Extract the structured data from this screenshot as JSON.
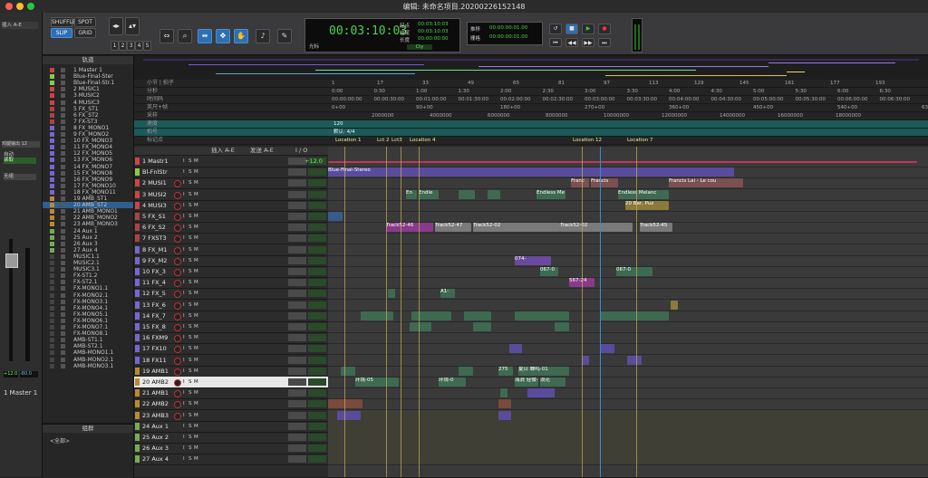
{
  "window": {
    "title": "编辑: 未命名项目.20200226152148"
  },
  "toolbar": {
    "edit_modes": [
      "SHUFFLE",
      "SPOT",
      "SLIP",
      "GRID"
    ],
    "zoom_presets": [
      "1",
      "2",
      "3",
      "4",
      "5"
    ],
    "main_counter": "00:03:10:03",
    "counter_label": "光标",
    "start_label": "起点",
    "end_label": "结尾",
    "length_label": "长度",
    "start_value": "00:03:10:03",
    "end_value": "00:03:10:03",
    "length_value": "00:00:00:00",
    "nudge_label": "推移",
    "grid_label": "栅格",
    "nudge_value": "00:00:00:01.00",
    "grid_value": "00:00:00:01.00",
    "grid_text": "Cty"
  },
  "left_strip": {
    "insert_label": "插入 A-E",
    "track_label": "鸡腿输出 12",
    "auto_label": "自动",
    "auto_value": "读取",
    "group_label": "无组",
    "fader_left": "+12.0",
    "fader_right": "-80.0",
    "track_name": "1  Master 1"
  },
  "tracklist": {
    "header": "轨道",
    "items": [
      "1 Master 1",
      "Blue-Final-Ster",
      "Blue-Final-Str.1",
      "2 MUSIC1",
      "3 MUSIC2",
      "4 MUSIC3",
      "5 FX_ST1",
      "6 FX_ST2",
      "7 FX-ST3",
      "8 FX_MONO1",
      "9 FX_MONO2",
      "10 FX_MONO3",
      "11 FX_MONO4",
      "12 FX_MONO5",
      "13 FX_MONO6",
      "14 FX_MONO7",
      "15 FX_MONO8",
      "16 FX_MONO9",
      "17 FX_MONO10",
      "18 FX_MONO11",
      "19 AMB_ST1",
      "20 AMB_ST2",
      "21 AMB_MONO1",
      "22 AMB_MONO2",
      "23 AMB_MONO3",
      "24 Aux 1",
      "25 Aux 2",
      "26 Aux 3",
      "27 Aux 4",
      "MUSIC1.1",
      "MUSIC2.1",
      "MUSIC3.1",
      "FX-ST1.2",
      "FX-ST2.1",
      "FX-MONO1.1",
      "FX-MONO2.1",
      "FX-MONO3.1",
      "FX-MONO4.1",
      "FX-MONO5.1",
      "FX-MONO6.1",
      "FX-MONO7.1",
      "FX-MONO8.1",
      "AMB-ST1.1",
      "AMB-ST2.1",
      "AMB-MONO1.1",
      "AMB-MONO2.1",
      "AMB-MONO3.1"
    ],
    "groups_header": "组群",
    "groups_item": "<全部>"
  },
  "rulers": {
    "labels": [
      "小节 | 拍子",
      "分秒",
      "时间码",
      "英尺+帧",
      "采样",
      "速度",
      "拍号",
      "标记点"
    ],
    "bars": [
      "1",
      "17",
      "33",
      "49",
      "65",
      "81",
      "97",
      "113",
      "129",
      "145",
      "161",
      "177",
      "193"
    ],
    "minsecs": [
      "0:00",
      "0:30",
      "1:00",
      "1:30",
      "2:00",
      "2:30",
      "3:00",
      "3:30",
      "4:00",
      "4:30",
      "5:00",
      "5:30",
      "6:00",
      "6:30"
    ],
    "timecodes": [
      "00:00:00:00",
      "00:00:30:00",
      "00:01:00:00",
      "00:01:30:00",
      "00:02:00:00",
      "00:02:30:00",
      "00:03:00:00",
      "00:03:30:00",
      "00:04:00:00",
      "00:04:30:00",
      "00:05:00:00",
      "00:05:30:00",
      "00:06:00:00",
      "00:06:30:00"
    ],
    "feet": [
      "0+00",
      "90+00",
      "180+00",
      "270+00",
      "360+00",
      "450+00",
      "540+00",
      "630+00"
    ],
    "samples": [
      "2000000",
      "4000000",
      "6000000",
      "8000000",
      "10000000",
      "12000000",
      "14000000",
      "16000000",
      "18000000"
    ],
    "tempo": "120",
    "meter": "默认: 4/4",
    "markers": [
      "Location 1",
      "Lct 2",
      "Lct3",
      "Location 4",
      "Location 12",
      "Location 7"
    ]
  },
  "track_header": {
    "col_insert": "插入 A-E",
    "col_send": "发送 A-E",
    "col_io": "I / O"
  },
  "tracks": [
    {
      "name": "1  Mastr1",
      "color": "#c44",
      "level": "+12.0"
    },
    {
      "name": "Bl-FnlStr",
      "color": "#8c4",
      "level": ""
    },
    {
      "name": "2  MUSI1",
      "color": "#c44",
      "level": ""
    },
    {
      "name": "3  MUSI2",
      "color": "#c44",
      "level": ""
    },
    {
      "name": "4  MUSI3",
      "color": "#c44",
      "level": ""
    },
    {
      "name": "5  FX_S1",
      "color": "#a44",
      "level": ""
    },
    {
      "name": "6  FX_S2",
      "color": "#a44",
      "level": ""
    },
    {
      "name": "7  FXST3",
      "color": "#a44",
      "level": ""
    },
    {
      "name": "8  FX_M1",
      "color": "#76c",
      "level": ""
    },
    {
      "name": "9  FX_M2",
      "color": "#76c",
      "level": ""
    },
    {
      "name": "10 FX_3",
      "color": "#76c",
      "level": ""
    },
    {
      "name": "11 FX_4",
      "color": "#76c",
      "level": ""
    },
    {
      "name": "12 FX_5",
      "color": "#76c",
      "level": ""
    },
    {
      "name": "13 FX_6",
      "color": "#76c",
      "level": ""
    },
    {
      "name": "14 FX_7",
      "color": "#76c",
      "level": ""
    },
    {
      "name": "15 FX_8",
      "color": "#76c",
      "level": ""
    },
    {
      "name": "16 FXM9",
      "color": "#76c",
      "level": ""
    },
    {
      "name": "17 FX10",
      "color": "#76c",
      "level": ""
    },
    {
      "name": "18 FX11",
      "color": "#76c",
      "level": ""
    },
    {
      "name": "19 AMB1",
      "color": "#b83",
      "level": ""
    },
    {
      "name": "20 AMB2",
      "color": "#b83",
      "level": ""
    },
    {
      "name": "21 AMB1",
      "color": "#b83",
      "level": ""
    },
    {
      "name": "22 AMB2",
      "color": "#b83",
      "level": ""
    },
    {
      "name": "23 AMB3",
      "color": "#b83",
      "level": ""
    },
    {
      "name": "24  Aux 1",
      "color": "#7a5",
      "level": ""
    },
    {
      "name": "25  Aux 2",
      "color": "#7a5",
      "level": ""
    },
    {
      "name": "26  Aux 3",
      "color": "#7a5",
      "level": ""
    },
    {
      "name": "27  Aux 4",
      "color": "#7a5",
      "level": ""
    }
  ],
  "clips": {
    "master": "Blue-Final-Stereo",
    "music1a": "Franc",
    "music1b": "Francis",
    "music1c": "Francis Lai - Le cou",
    "music2a": "En",
    "music2b": "Endle",
    "music2c": "Endless Me",
    "music2d": "Endless Melanc",
    "music3": "20 Bar, Puz",
    "fxs2a": "Track52-46",
    "fxs2b": "Track52-47",
    "fxs2c": "Track52-02",
    "fxs2d": "Track52-02",
    "fxs2e": "Track52-45",
    "fxm2": "074-",
    "fx3": "067-0",
    "fx4": "567-24",
    "fx6": "A1-",
    "amb1": "275",
    "amb1b": "夏日 蝉鸣-01",
    "amb2": "环境-05",
    "amb2b": "环境-0",
    "amb2c": "海浪 轻微-02",
    "amb2d": "浪花"
  }
}
